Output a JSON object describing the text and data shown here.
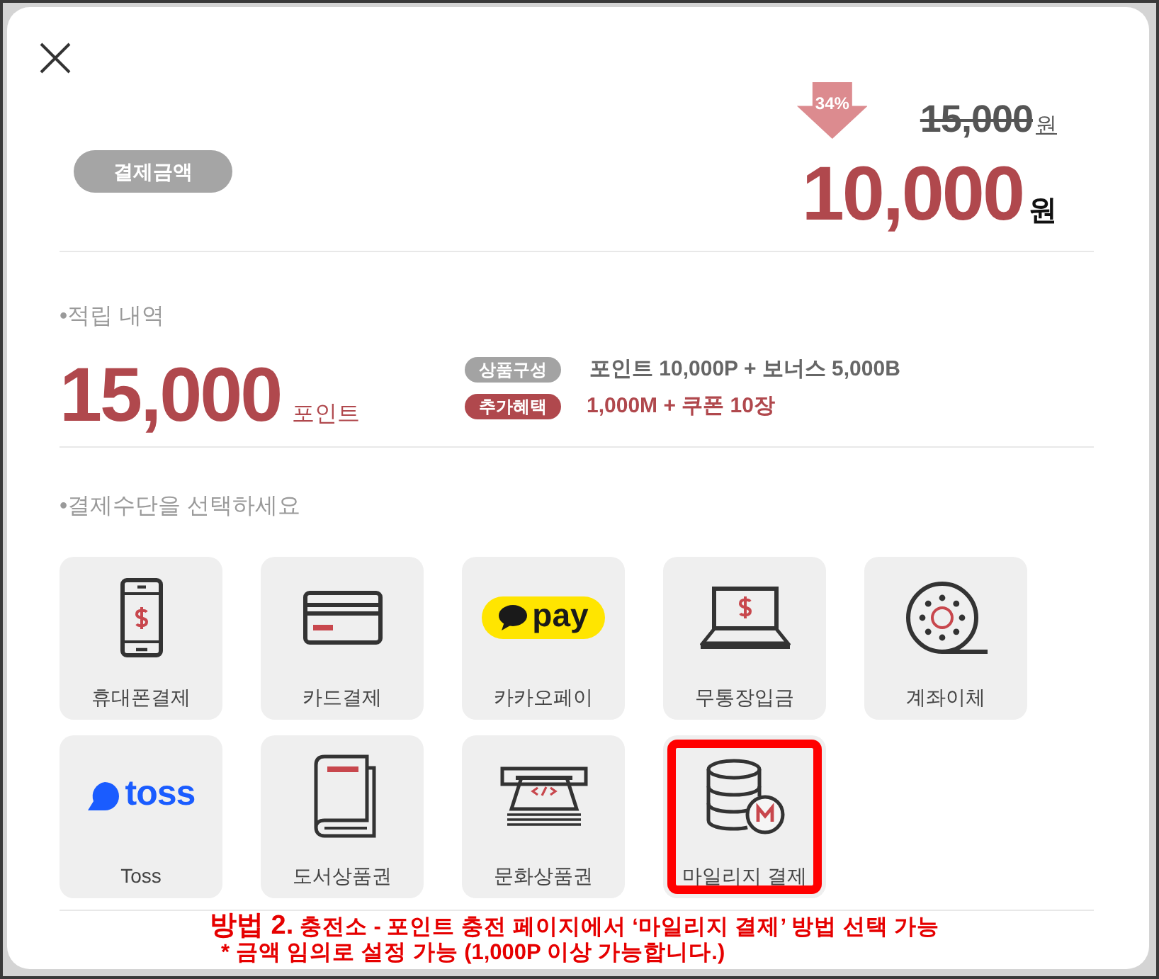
{
  "payment_amount": {
    "badge": "결제금액",
    "discount": "34%",
    "original_price": "15,000",
    "original_unit": "원",
    "price": "10,000",
    "unit": "원"
  },
  "earned_points": {
    "heading": "•적립 내역",
    "amount": "15,000",
    "unit": "포인트",
    "details": [
      {
        "kind": "composition",
        "tag": "상품구성",
        "text": "포인트 10,000P + 보너스 5,000B"
      },
      {
        "kind": "bonus",
        "tag": "추가혜택",
        "text": "1,000M + 쿠폰 10장"
      }
    ]
  },
  "payment_methods": {
    "heading": "•결제수단을 선택하세요",
    "items": [
      {
        "kind": "phone",
        "label": "휴대폰결제",
        "highlighted": false
      },
      {
        "kind": "card",
        "label": "카드결제",
        "highlighted": false
      },
      {
        "kind": "kakaopay",
        "label": "카카오페이",
        "logo_text": "pay",
        "highlighted": false
      },
      {
        "kind": "laptop",
        "label": "무통장입금",
        "highlighted": false
      },
      {
        "kind": "reel",
        "label": "계좌이체",
        "highlighted": false
      },
      {
        "kind": "toss",
        "label": "Toss",
        "logo_text": "toss",
        "highlighted": false
      },
      {
        "kind": "book",
        "label": "도서상품권",
        "highlighted": false
      },
      {
        "kind": "ticket_machine",
        "label": "문화상품권",
        "highlighted": false
      },
      {
        "kind": "database",
        "label": "마일리지 결제",
        "highlighted": true
      }
    ]
  },
  "annotation": {
    "label": "방법 2.",
    "text": "충전소 - 포인트 충전 페이지에서 ‘마일리지 결제’ 방법 선택 가능",
    "note": "* 금액 임의로 설정 가능 (1,000P 이상 가능합니다.)"
  }
}
